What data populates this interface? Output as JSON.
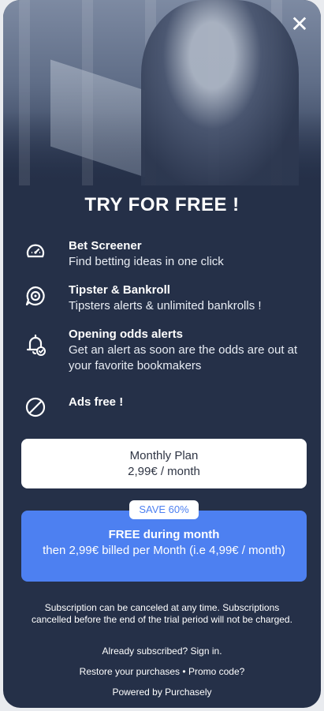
{
  "header": {
    "close_icon": "close-icon",
    "close_symbol": "✕"
  },
  "title": "TRY FOR FREE !",
  "features": [
    {
      "icon": "speedometer-icon",
      "title": "Bet Screener",
      "desc": "Find betting ideas in one click"
    },
    {
      "icon": "target-chat-icon",
      "title": "Tipster & Bankroll",
      "desc": "Tipsters alerts & unlimited bankrolls !"
    },
    {
      "icon": "bell-alert-icon",
      "title": "Opening odds alerts",
      "desc": "Get an alert as soon are the odds are out at your favorite bookmakers"
    },
    {
      "icon": "no-ads-icon",
      "title": "Ads free !",
      "desc": ""
    }
  ],
  "plans": {
    "monthly": {
      "name": "Monthly Plan",
      "price": "2,99€ / month"
    },
    "badge": "SAVE 60%",
    "free": {
      "name": "FREE during month",
      "desc": "then 2,99€ billed per Month (i.e 4,99€ / month)"
    }
  },
  "footer": {
    "disclaimer": "Subscription can be canceled at any time. Subscriptions cancelled before the end of the trial period will not be charged.",
    "signin": "Already subscribed? Sign in.",
    "restore": "Restore your purchases",
    "separator": "•",
    "promo": "Promo code?",
    "powered": "Powered by Purchasely"
  },
  "colors": {
    "background": "#253048",
    "accent": "#4d80f1",
    "card": "#ffffff"
  }
}
